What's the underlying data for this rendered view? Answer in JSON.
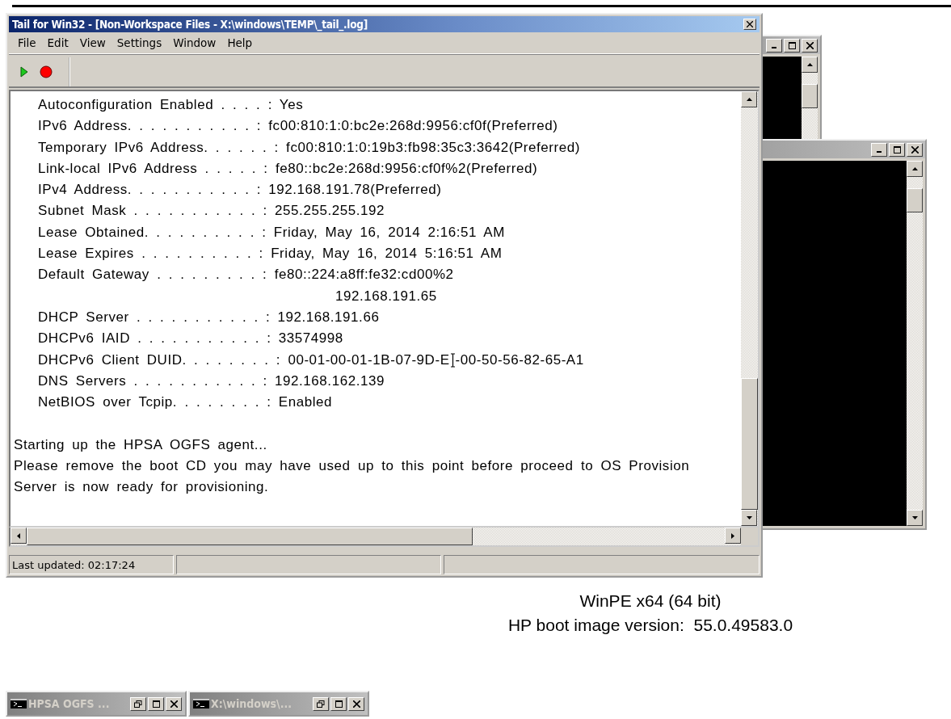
{
  "window": {
    "title": "Tail for Win32 - [Non-Workspace Files - X:\\windows\\TEMP\\_tail_.log]"
  },
  "menu": [
    "File",
    "Edit",
    "View",
    "Settings",
    "Window",
    "Help"
  ],
  "log": [
    {
      "kind": "entry",
      "text": "Autoconfiguration Enabled . . . . : Yes"
    },
    {
      "kind": "entry",
      "text": "IPv6 Address. . . . . . . . . . . : fc00:810:1:0:bc2e:268d:9956:cf0f(Preferred)"
    },
    {
      "kind": "entry",
      "text": "Temporary IPv6 Address. . . . . . : fc00:810:1:0:19b3:fb98:35c3:3642(Preferred)"
    },
    {
      "kind": "entry",
      "text": "Link-local IPv6 Address . . . . . : fe80::bc2e:268d:9956:cf0f%2(Preferred)"
    },
    {
      "kind": "entry",
      "text": "IPv4 Address. . . . . . . . . . . : 192.168.191.78(Preferred)"
    },
    {
      "kind": "entry",
      "text": "Subnet Mask . . . . . . . . . . . : 255.255.255.192"
    },
    {
      "kind": "entry",
      "text": "Lease Obtained. . . . . . . . . . : Friday, May 16, 2014 2:16:51 AM"
    },
    {
      "kind": "entry",
      "text": "Lease Expires . . . . . . . . . . : Friday, May 16, 2014 5:16:51 AM"
    },
    {
      "kind": "entry",
      "text": "Default Gateway . . . . . . . . . : fe80::224:a8ff:fe32:cd00%2"
    },
    {
      "kind": "continuation",
      "text": "192.168.191.65"
    },
    {
      "kind": "entry",
      "text": "DHCP Server . . . . . . . . . . . : 192.168.191.66"
    },
    {
      "kind": "entry",
      "text": "DHCPv6 IAID . . . . . . . . . . . : 33574998"
    },
    {
      "kind": "cursor",
      "text": "DHCPv6 Client DUID. . . . . . . . : 00-01-00-01-1B-07-9D-E",
      "after": "-00-50-56-82-65-A1"
    },
    {
      "kind": "entry",
      "text": "DNS Servers . . . . . . . . . . . : 192.168.162.139"
    },
    {
      "kind": "entry",
      "text": "NetBIOS over Tcpip. . . . . . . . : Enabled"
    },
    {
      "kind": "blank"
    },
    {
      "kind": "message",
      "text": "Starting up the HPSA OGFS agent..."
    },
    {
      "kind": "message",
      "text": "Please remove the boot CD you may have used up to this point before proceed to OS Provision"
    },
    {
      "kind": "message",
      "text": "Server is now ready for provisioning."
    }
  ],
  "status_bar": {
    "text": "Last updated: 02:17:24"
  },
  "info": [
    "WinPE x64 (64 bit)",
    "HP boot image version:  55.0.49583.0"
  ],
  "taskbar": [
    {
      "title": "HPSA OGFS ..."
    },
    {
      "title": "X:\\windows\\..."
    }
  ]
}
